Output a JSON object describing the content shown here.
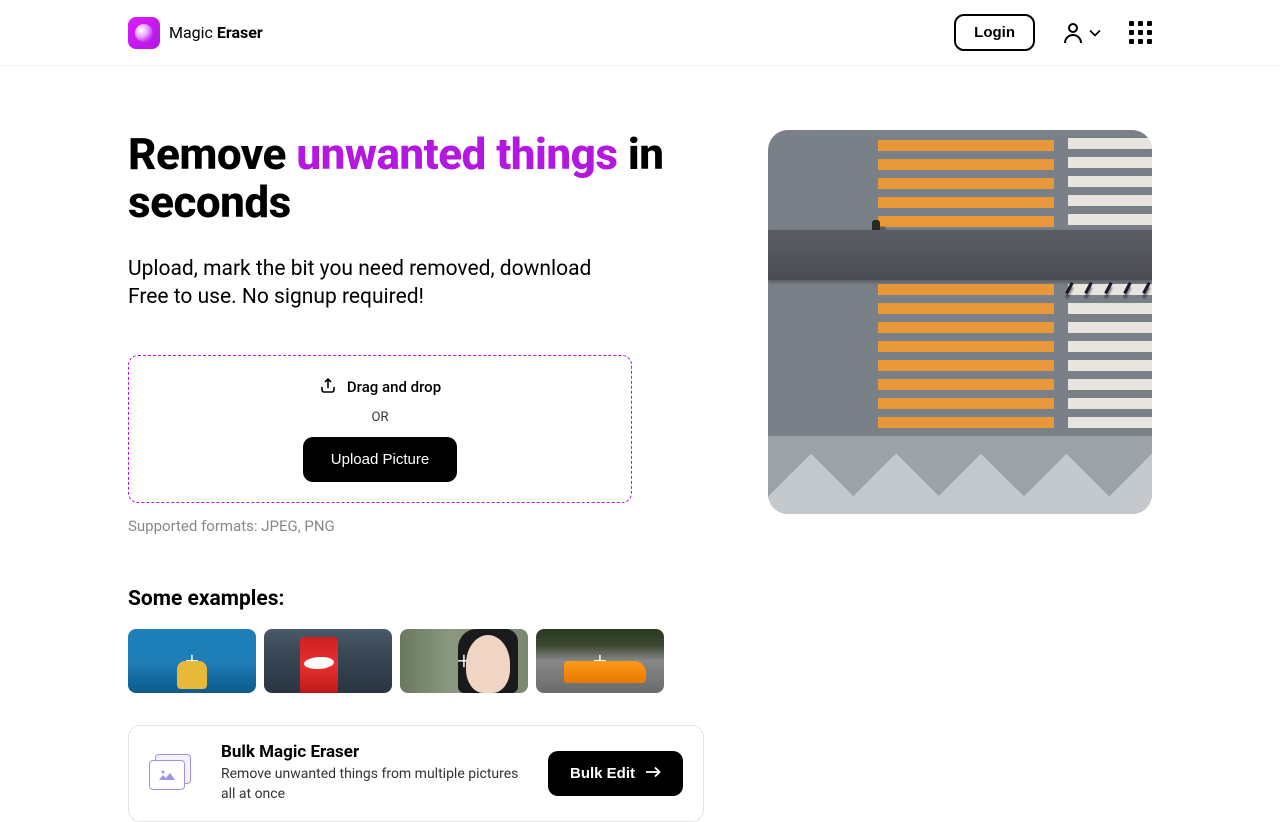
{
  "header": {
    "logo_text_light": "Magic ",
    "logo_text_bold": "Eraser",
    "login_label": "Login"
  },
  "hero": {
    "title_pre": "Remove ",
    "title_highlight": "unwanted things",
    "title_post": " in seconds",
    "sub_line1": "Upload, mark the bit you need removed, download",
    "sub_line2": "Free to use. No signup required!"
  },
  "upload": {
    "drag_label": "Drag and drop",
    "or_label": "OR",
    "button_label": "Upload Picture",
    "formats_label": "Supported formats: JPEG, PNG"
  },
  "examples": {
    "title": "Some examples:"
  },
  "bulk": {
    "title": "Bulk Magic Eraser",
    "desc": "Remove unwanted things from multiple pictures all at once",
    "button_label": "Bulk Edit"
  }
}
